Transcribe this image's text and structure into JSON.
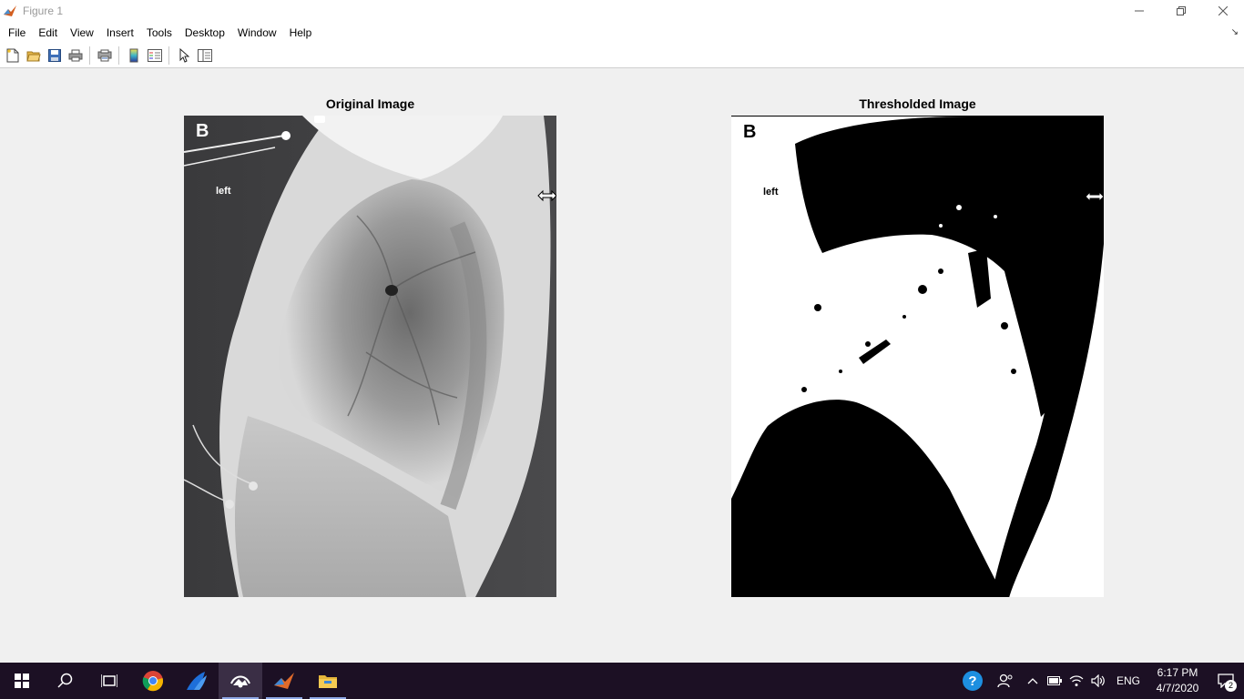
{
  "window": {
    "title": "Figure 1"
  },
  "menu": {
    "items": [
      "File",
      "Edit",
      "View",
      "Insert",
      "Tools",
      "Desktop",
      "Window",
      "Help"
    ],
    "dock_arrow": "↘"
  },
  "toolbar": {
    "buttons": [
      "new-figure-icon",
      "open-file-icon",
      "save-icon",
      "print-icon",
      "print-preview-icon",
      "colorbar-icon",
      "legend-icon",
      "edit-plot-arrow-icon",
      "property-inspector-icon"
    ]
  },
  "figure": {
    "left_axes": {
      "title": "Original Image",
      "letter": "B",
      "side_label": "left"
    },
    "right_axes": {
      "title": "Thresholded Image",
      "letter": "B",
      "side_label": "left"
    }
  },
  "taskbar": {
    "apps": [
      "start-icon",
      "search-icon",
      "task-view-icon",
      "chrome-icon",
      "wireshark-icon",
      "image-viewer-icon",
      "matlab-icon",
      "file-explorer-icon"
    ],
    "tray": {
      "language": "ENG",
      "time": "6:17 PM",
      "date": "4/7/2020",
      "notification_count": "2"
    }
  },
  "colors": {
    "taskbar_bg": "#1c1024",
    "figure_bg": "#f0f0f0",
    "accent": "#0078d7"
  }
}
